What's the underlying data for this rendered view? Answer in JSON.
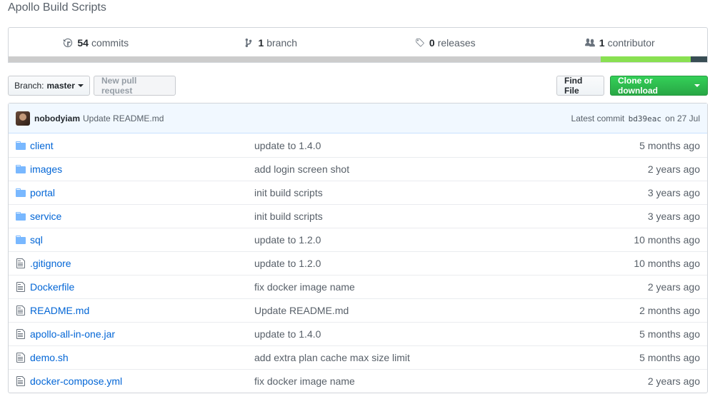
{
  "repo": {
    "description": "Apollo Build Scripts"
  },
  "summary": {
    "commits_count": "54",
    "commits_label": "commits",
    "branches_count": "1",
    "branches_label": "branch",
    "releases_count": "0",
    "releases_label": "releases",
    "contributors_count": "1",
    "contributors_label": "contributor",
    "languages": [
      {
        "color": "#cccccc",
        "share": 0.848
      },
      {
        "color": "#89e051",
        "share": 0.128
      },
      {
        "color": "#384d54",
        "share": 0.024
      }
    ]
  },
  "toolbar": {
    "branch_prefix": "Branch:",
    "branch_name": "master",
    "new_pr_label": "New pull request",
    "find_file_label": "Find File",
    "clone_label": "Clone or download"
  },
  "commit": {
    "author": "nobodyiam",
    "message": "Update README.md",
    "latest_label": "Latest commit",
    "sha": "bd39eac",
    "date": "on 27 Jul"
  },
  "files": [
    {
      "type": "dir",
      "name": "client",
      "message": "update to 1.4.0",
      "age": "5 months ago"
    },
    {
      "type": "dir",
      "name": "images",
      "message": "add login screen shot",
      "age": "2 years ago"
    },
    {
      "type": "dir",
      "name": "portal",
      "message": "init build scripts",
      "age": "3 years ago"
    },
    {
      "type": "dir",
      "name": "service",
      "message": "init build scripts",
      "age": "3 years ago"
    },
    {
      "type": "dir",
      "name": "sql",
      "message": "update to 1.2.0",
      "age": "10 months ago"
    },
    {
      "type": "file",
      "name": ".gitignore",
      "message": "update to 1.2.0",
      "age": "10 months ago"
    },
    {
      "type": "file",
      "name": "Dockerfile",
      "message": "fix docker image name",
      "age": "2 years ago"
    },
    {
      "type": "file",
      "name": "README.md",
      "message": "Update README.md",
      "age": "2 months ago"
    },
    {
      "type": "file",
      "name": "apollo-all-in-one.jar",
      "message": "update to 1.4.0",
      "age": "5 months ago"
    },
    {
      "type": "file",
      "name": "demo.sh",
      "message": "add extra plan cache max size limit",
      "age": "5 months ago"
    },
    {
      "type": "file",
      "name": "docker-compose.yml",
      "message": "fix docker image name",
      "age": "2 years ago"
    }
  ]
}
